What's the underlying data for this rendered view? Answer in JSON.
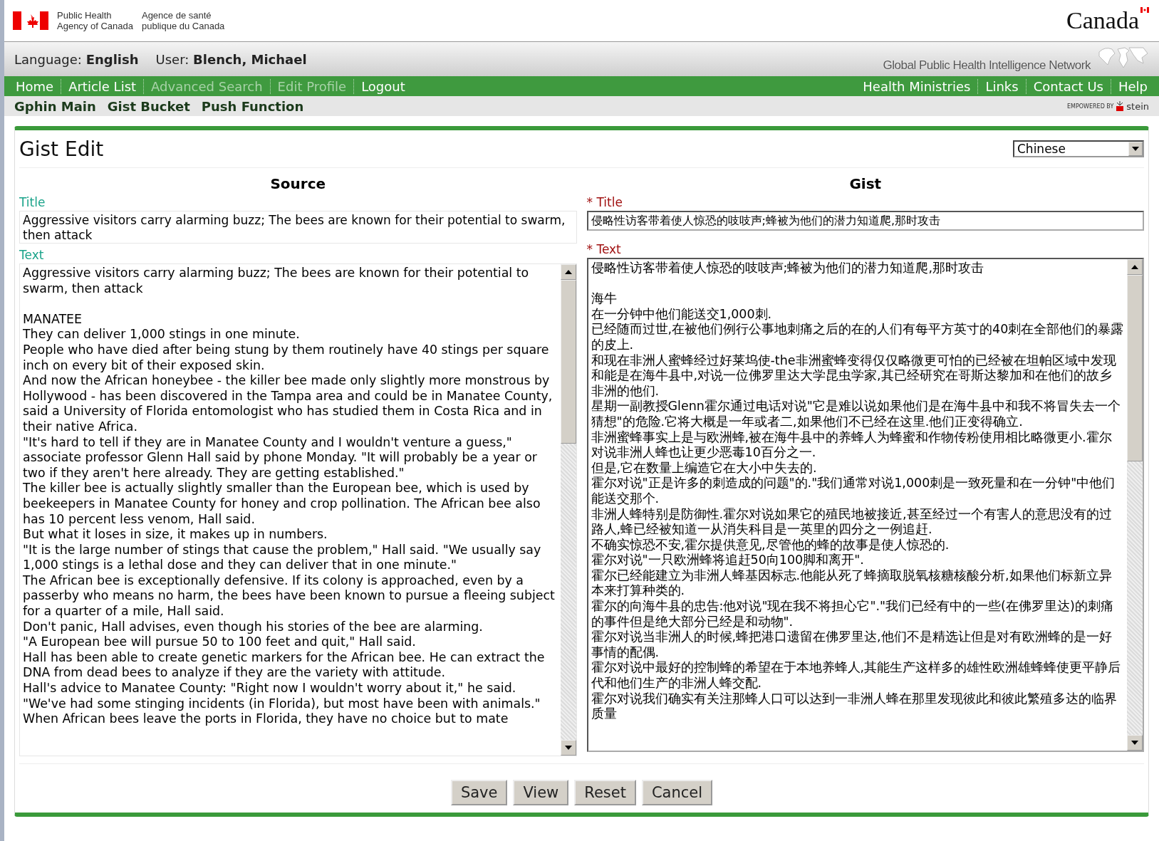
{
  "header": {
    "agency_en": [
      "Public Health",
      "Agency of Canada"
    ],
    "agency_fr": [
      "Agence de santé",
      "publique du Canada"
    ],
    "wordmark": "Canada"
  },
  "user_bar": {
    "language_label": "Language:",
    "language": "English",
    "user_label": "User:",
    "user": "Blench, Michael",
    "network_name": [
      "Global",
      "Public",
      "Health",
      "Intelligence",
      "Network"
    ]
  },
  "main_nav": [
    {
      "label": "Home",
      "disabled": false
    },
    {
      "label": "Article List",
      "disabled": false
    },
    {
      "label": "Advanced Search",
      "disabled": true
    },
    {
      "label": "Edit Profile",
      "disabled": true
    },
    {
      "label": "Logout",
      "disabled": false
    }
  ],
  "right_nav": [
    {
      "label": "Health Ministries"
    },
    {
      "label": "Links"
    },
    {
      "label": "Contact Us"
    },
    {
      "label": "Help"
    }
  ],
  "sub_nav": [
    "Gphin Main",
    "Gist Bucket",
    "Push Function"
  ],
  "powered_by": {
    "label": "EMPOWERED BY",
    "brand": "stein"
  },
  "page_title": "Gist Edit",
  "language_select": {
    "value": "Chinese"
  },
  "source": {
    "heading": "Source",
    "title_label": "Title",
    "title": "Aggressive visitors carry alarming buzz; The bees are known for their potential to swarm, then attack",
    "text_label": "Text",
    "paragraphs": [
      "Aggressive visitors carry alarming buzz; The bees are known for their potential to swarm, then attack",
      "MANATEE",
      "They can deliver 1,000 stings in one minute.",
      "People who have died after being stung by them routinely have 40 stings per square inch on every bit of their exposed skin.",
      "And now the African honeybee - the killer bee made only slightly more monstrous by Hollywood - has been discovered in the Tampa area and could be in Manatee County, said a University of Florida entomologist who has studied them in Costa Rica and in their native Africa.",
      "\"It's hard to tell if they are in Manatee County and I wouldn't venture a guess,\" associate professor Glenn Hall said by phone Monday. \"It will probably be a year or two if they aren't here already. They are getting established.\"",
      "The killer bee is actually slightly smaller than the European bee, which is used by beekeepers in Manatee County for honey and crop pollination. The African bee also has 10 percent less venom, Hall said.",
      "But what it loses in size, it makes up in numbers.",
      "\"It is the large number of stings that cause the problem,\" Hall said. \"We usually say 1,000 stings is a lethal dose and they can deliver that in one minute.\"",
      "The African bee is exceptionally defensive. If its colony is approached, even by a passerby who means no harm, the bees have been known to pursue a fleeing subject for a quarter of a mile, Hall said.",
      "Don't panic, Hall advises, even though his stories of the bee are alarming.",
      "\"A European bee will pursue 50 to 100 feet and quit,\" Hall said.",
      "Hall has been able to create genetic markers for the African bee. He can extract the DNA from dead bees to analyze if they are the variety with attitude.",
      "Hall's advice to Manatee County: \"Right now I wouldn't worry about it,\" he said. \"We've had some stinging incidents (in Florida), but most have been with animals.\"",
      "When African bees leave the ports in Florida, they have no choice but to mate"
    ]
  },
  "gist": {
    "heading": "Gist",
    "required_mark": "*",
    "title_label": "Title",
    "title": "侵略性访客带着使人惊恐的吱吱声;蜂被为他们的潜力知道爬,那时攻击",
    "text_label": "Text",
    "paragraphs": [
      "侵略性访客带着使人惊恐的吱吱声;蜂被为他们的潜力知道爬,那时攻击",
      "海牛",
      "在一分钟中他们能送交1,000刺.",
      "已经随而过世,在被他们例行公事地刺痛之后的在的人们有每平方英寸的40刺在全部他们的暴露的皮上.",
      "和现在非洲人蜜蜂经过好莱坞使-the非洲蜜蜂变得仅仅略微更可怕的已经被在坦帕区域中发现和能是在海牛县中,对说一位佛罗里达大学昆虫学家,其已经研究在哥斯达黎加和在他们的故乡非洲的他们.",
      "星期一副教授Glenn霍尔通过电话对说\"它是难以说如果他们是在海牛县中和我不将冒失去一个猜想\"的危险.它将大概是一年或者二,如果他们不已经在这里.他们正变得确立.",
      "非洲蜜蜂事实上是与欧洲蜂,被在海牛县中的养蜂人为蜂蜜和作物传粉使用相比略微更小.霍尔对说非洲人蜂也让更少恶毒10百分之一.",
      "但是,它在数量上编造它在大小中失去的.",
      "霍尔对说\"正是许多的刺造成的问题\"的.\"我们通常对说1,000刺是一致死量和在一分钟\"中他们能送交那个.",
      "非洲人蜂特别是防御性.霍尔对说如果它的殖民地被接近,甚至经过一个有害人的意思没有的过路人,蜂已经被知道一从消失科目是一英里的四分之一例追赶.",
      "不确实惊恐不安,霍尔提供意见,尽管他的蜂的故事是使人惊恐的.",
      "霍尔对说\"一只欧洲蜂将追赶50向100脚和离开\".",
      "霍尔已经能建立为非洲人蜂基因标志.他能从死了蜂摘取脱氧核糖核酸分析,如果他们标新立异本来打算种类的.",
      "霍尔的向海牛县的忠告:他对说\"现在我不将担心它\".\"我们已经有中的一些(在佛罗里达)的刺痛的事件但是绝大部分已经是和动物\".",
      "霍尔对说当非洲人的时候,蜂把港口遗留在佛罗里达,他们不是精选让但是对有欧洲蜂的是一好事情的配偶.",
      "霍尔对说中最好的控制蜂的希望在于本地养蜂人,其能生产这样多的雄性欧洲雄蜂蜂使更平静后代和他们生产的非洲人蜂交配.",
      "霍尔对说我们确实有关注那蜂人口可以达到一非洲人蜂在那里发现彼此和彼此繁殖多达的临界质量"
    ]
  },
  "buttons": [
    "Save",
    "View",
    "Reset",
    "Cancel"
  ]
}
